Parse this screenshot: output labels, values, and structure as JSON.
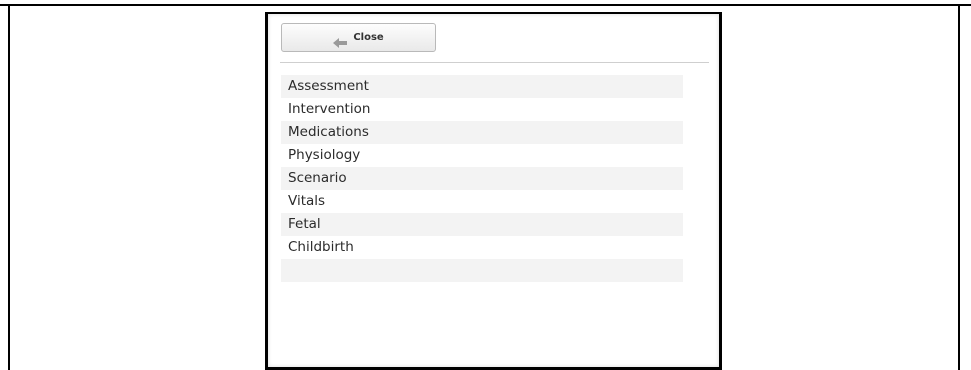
{
  "dialog": {
    "close_label": "Close",
    "close_icon": "arrow-left-icon"
  },
  "menu": {
    "items": [
      {
        "label": "Assessment"
      },
      {
        "label": "Intervention"
      },
      {
        "label": "Medications"
      },
      {
        "label": "Physiology"
      },
      {
        "label": "Scenario"
      },
      {
        "label": "Vitals"
      },
      {
        "label": "Fetal"
      },
      {
        "label": "Childbirth"
      },
      {
        "label": ""
      }
    ]
  }
}
